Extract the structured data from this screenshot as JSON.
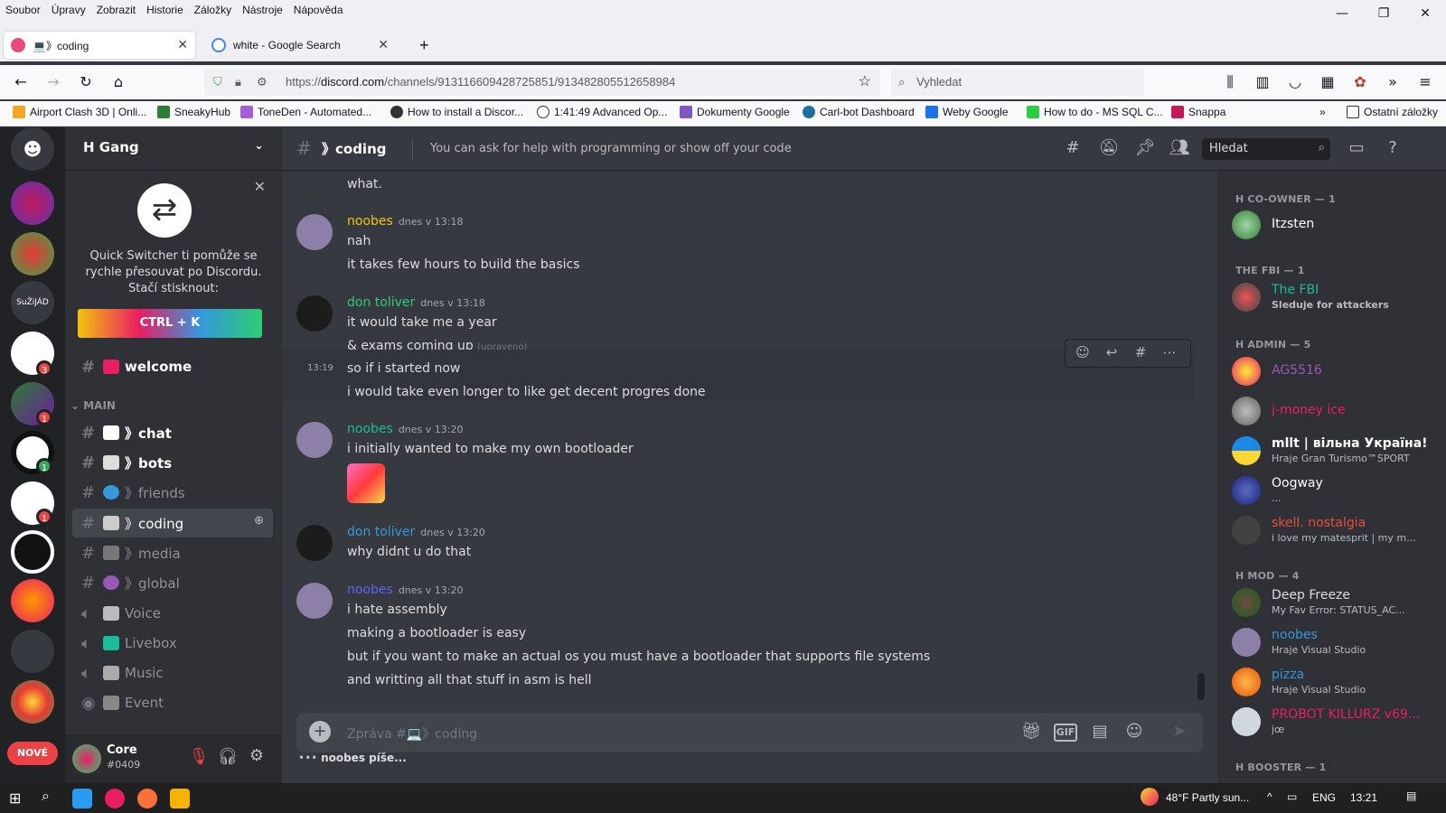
{
  "browser": {
    "menu": [
      "Soubor",
      "Úpravy",
      "Zobrazit",
      "Historie",
      "Záložky",
      "Nástroje",
      "Nápověda"
    ],
    "tabs": [
      {
        "label": "💻》coding",
        "active": true
      },
      {
        "label": "white - Google Search",
        "active": false
      }
    ],
    "url_prefix": "https://",
    "url_host": "discord.com",
    "url_path": "/channels/913116609428725851/913482805512658984",
    "search_placeholder": "Vyhledat",
    "bookmarks": [
      "Airport Clash 3D | Onli...",
      "SneakyHub",
      "ToneDen - Automated...",
      "How to install a Discor...",
      "1:41:49  Advanced Op...",
      "Dokumenty Google",
      "Carl-bot Dashboard",
      "Weby Google",
      "How to do - MS SQL C...",
      "Snappa"
    ],
    "other_bookmarks": "Ostatní záložky"
  },
  "server": {
    "name": "H Gang",
    "quick_switcher_text": "Quick Switcher ti pomůže se rychle přesouvat po Discordu. Stačí stisknout:",
    "shortcut": "CTRL + K",
    "channels": [
      {
        "name": "welcome",
        "type": "text",
        "bold": true,
        "emoji_color": "#e91e63"
      },
      {
        "category": "MAIN"
      },
      {
        "name": "》chat",
        "type": "text",
        "bold": true,
        "emoji_color": "#ffffff"
      },
      {
        "name": "》bots",
        "type": "text",
        "bold": true,
        "emoji_color": "#dddddd"
      },
      {
        "name": "》friends",
        "type": "text",
        "bold": false,
        "emoji_color": "#3498db"
      },
      {
        "name": "》coding",
        "type": "text",
        "bold": false,
        "selected": true,
        "emoji_color": "#cccccc"
      },
      {
        "name": "》media",
        "type": "text",
        "bold": false,
        "emoji_color": "#777777"
      },
      {
        "name": "》global",
        "type": "text",
        "bold": false,
        "emoji_color": "#9b59b6"
      },
      {
        "name": "Voice",
        "type": "voice",
        "bold": false,
        "emoji_color": "#bbbbbb"
      },
      {
        "name": "Livebox",
        "type": "voice",
        "bold": false,
        "emoji_color": "#1abc9c"
      },
      {
        "name": "Music",
        "type": "voice",
        "bold": false,
        "emoji_color": "#aaaaaa"
      },
      {
        "name": "Event",
        "type": "stage",
        "bold": false,
        "emoji_color": "#888888"
      }
    ],
    "user": {
      "name": "Core",
      "tag": "#0409"
    },
    "guild_badges": [
      "3",
      "1",
      "1",
      "1"
    ],
    "guild_label": "SuŽiJÁD",
    "new_badge": "NOVÉ"
  },
  "channel": {
    "name": "》coding",
    "topic": "You can ask for help with programming or show off your code",
    "search_placeholder": "Hledat",
    "composer_placeholder": "Zpráva #💻》coding",
    "typing": "noobes píše..."
  },
  "messages": [
    {
      "lines": [
        "what."
      ]
    },
    {
      "author": "noobes",
      "color": "#f1c40f",
      "time": "dnes v 13:18",
      "lines": [
        "nah",
        "it takes few hours to build the basics"
      ]
    },
    {
      "author": "don toliver",
      "color": "#2ecc71",
      "time": "dnes v 13:18",
      "lines": [
        "it would take me a year",
        "& exams coming up"
      ],
      "edited": "(upraveno)"
    },
    {
      "hover_time": "13:19",
      "lines": [
        "so if i started now",
        "i would take even longer to like get decent progres done"
      ]
    },
    {
      "author": "noobes",
      "color": "#1abc9c",
      "time": "dnes v 13:20",
      "lines": [
        "i initially wanted to make my own bootloader"
      ]
    },
    {
      "author": "don toliver",
      "color": "#3498db",
      "time": "dnes v 13:20",
      "lines": [
        "why didnt u do that"
      ]
    },
    {
      "author": "noobes",
      "color": "#5865f2",
      "time": "dnes v 13:20",
      "lines": [
        "i hate assembly",
        "making a bootloader is easy",
        "but if you want to make an actual os you must have a bootloader that supports file systems",
        "and writting all that stuff in asm is hell"
      ]
    }
  ],
  "members": {
    "groups": [
      {
        "title": "H CO-OWNER — 1",
        "members": [
          {
            "name": "Itzsten",
            "color": "#ffffff",
            "status": ""
          }
        ]
      },
      {
        "title": "THE FBI — 1",
        "members": [
          {
            "name": "The FBI",
            "color": "#1abc9c",
            "status": "Sleduje for attackers"
          }
        ]
      },
      {
        "title": "H ADMIN — 5",
        "members": [
          {
            "name": "AG5516",
            "color": "#9b59b6",
            "status": ""
          },
          {
            "name": "j-money ice",
            "color": "#e91e63",
            "status": ""
          },
          {
            "name": "mllt | вільна Україна!",
            "color": "#ffffff",
            "status": "Hraje Gran Turismo™SPORT"
          },
          {
            "name": "Oogway",
            "color": "#ffffff",
            "status": "..."
          },
          {
            "name": "skell. nostalgia",
            "color": "#e74c3c",
            "status": "i love my matesprit | my m..."
          }
        ]
      },
      {
        "title": "H MOD — 4",
        "members": [
          {
            "name": "Deep Freeze",
            "color": "#dcddde",
            "status": "My Fav Error: STATUS_AC..."
          },
          {
            "name": "noobes",
            "color": "#3498db",
            "status": "Hraje Visual Studio"
          },
          {
            "name": "pizza",
            "color": "#3498db",
            "status": "Hraje Visual Studio"
          },
          {
            "name": "PROBOT KILLURZ v69...",
            "color": "#e91e63",
            "status": "jœ"
          }
        ]
      },
      {
        "title": "H BOOSTER — 1",
        "members": []
      }
    ]
  },
  "taskbar": {
    "weather": "48°F  Partly sun...",
    "lang": "ENG",
    "time": "13:21"
  }
}
